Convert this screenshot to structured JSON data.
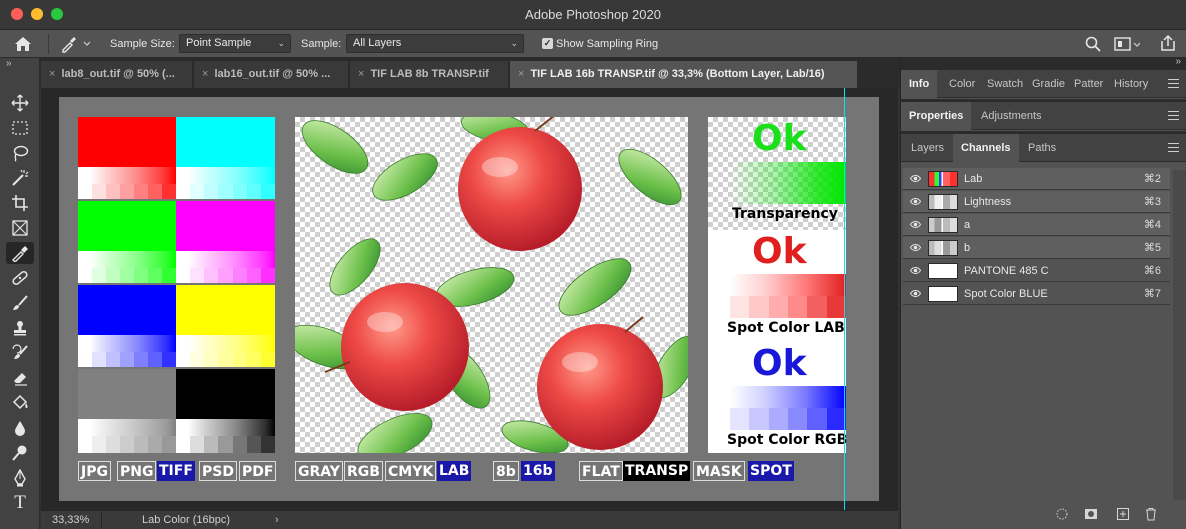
{
  "window": {
    "title": "Adobe Photoshop 2020"
  },
  "options_bar": {
    "sample_size_label": "Sample Size:",
    "sample_size_value": "Point Sample",
    "sample_label": "Sample:",
    "sample_value": "All Layers",
    "show_sampling_ring_label": "Show Sampling Ring",
    "show_sampling_ring_checked": true
  },
  "tabs": [
    {
      "label": "lab8_out.tif @ 50% (...",
      "active": false
    },
    {
      "label": "lab16_out.tif @ 50% ...",
      "active": false
    },
    {
      "label": "TIF LAB 8b TRANSP.tif",
      "active": false
    },
    {
      "label": "TIF LAB 16b TRANSP.tif @ 33,3% (Bottom Layer, Lab/16)",
      "active": true
    }
  ],
  "tools": [
    "move-icon",
    "marquee-icon",
    "lasso-icon",
    "magic-wand-icon",
    "crop-icon",
    "frame-icon",
    "eyedropper-icon",
    "healing-brush-icon",
    "brush-icon",
    "stamp-icon",
    "history-brush-icon",
    "eraser-icon",
    "paint-bucket-icon",
    "blur-icon",
    "dodge-icon",
    "pen-icon",
    "type-icon"
  ],
  "canvas": {
    "format_labels": [
      "JPG",
      "PNG",
      "TIFF",
      "PSD",
      "PDF"
    ],
    "mode_labels": [
      "GRAY",
      "RGB",
      "CMYK",
      "LAB"
    ],
    "depth_labels": [
      "8b",
      "16b"
    ],
    "type_labels": [
      "FLAT",
      "TRANSP",
      "MASK",
      "SPOT"
    ],
    "ok_text": "Ok",
    "caption_transparency": "Transparency",
    "caption_spot_lab": "Spot Color LAB",
    "caption_spot_rgb": "Spot Color RGB",
    "colors": {
      "ok_green": "#19e019",
      "ok_red": "#e02020",
      "ok_blue": "#1a18d8",
      "label_blue": "#1a18a8"
    }
  },
  "status_bar": {
    "zoom": "33,33%",
    "mode": "Lab Color (16bpc)"
  },
  "panels": {
    "top_tabs": [
      "Info",
      "Color",
      "Swatch",
      "Gradie",
      "Patter",
      "History"
    ],
    "mid_tabs": [
      "Properties",
      "Adjustments"
    ],
    "layer_tabs": [
      "Layers",
      "Channels",
      "Paths"
    ],
    "channels": [
      {
        "name": "Lab",
        "shortcut": "⌘2"
      },
      {
        "name": "Lightness",
        "shortcut": "⌘3"
      },
      {
        "name": "a",
        "shortcut": "⌘4"
      },
      {
        "name": "b",
        "shortcut": "⌘5"
      },
      {
        "name": "PANTONE 485 C",
        "shortcut": "⌘6"
      },
      {
        "name": "Spot Color BLUE",
        "shortcut": "⌘7"
      }
    ]
  }
}
